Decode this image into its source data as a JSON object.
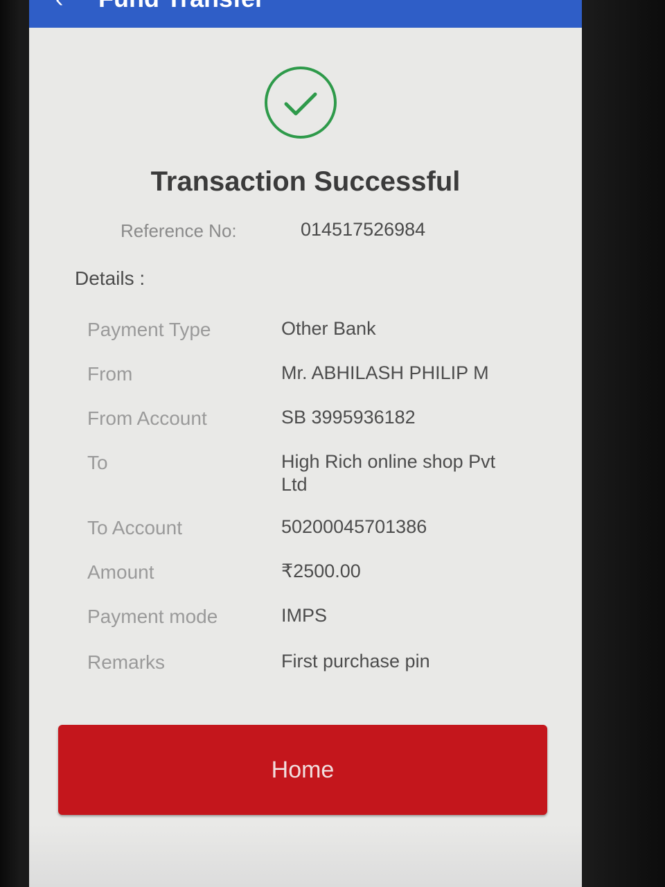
{
  "app_bar": {
    "back_icon": "back-arrow-icon",
    "title": "Fund Transfer",
    "color": "#2f5ec7"
  },
  "status": {
    "icon": "check-circle-icon",
    "icon_color": "#2e9a4a",
    "title": "Transaction Successful"
  },
  "reference": {
    "label": "Reference No:",
    "value": "014517526984"
  },
  "details": {
    "heading": "Details :",
    "rows": [
      {
        "label": "Payment Type",
        "value": "Other Bank"
      },
      {
        "label": "From",
        "value": "Mr. ABHILASH PHILIP M"
      },
      {
        "label": "From Account",
        "value": "SB 3995936182"
      },
      {
        "label": "To",
        "value": "High Rich online shop Pvt Ltd"
      },
      {
        "label": "To Account",
        "value": "50200045701386"
      },
      {
        "label": "Amount",
        "value": "₹2500.00"
      },
      {
        "label": "Payment mode",
        "value": "IMPS"
      },
      {
        "label": "Remarks",
        "value": "First  purchase pin"
      }
    ]
  },
  "home_button": {
    "label": "Home",
    "color": "#c4161c"
  }
}
